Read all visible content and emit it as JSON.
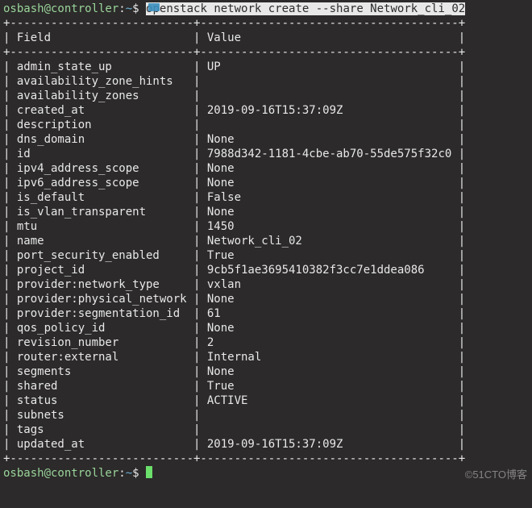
{
  "prompt": {
    "user": "osbash",
    "host": "controller",
    "path": "~",
    "symbol": "$"
  },
  "command": {
    "prefix": "openstack ",
    "rest": "network create --share Network_cli_02"
  },
  "table": {
    "header_field": "Field",
    "header_value": "Value",
    "rows": [
      {
        "field": "admin_state_up",
        "value": "UP"
      },
      {
        "field": "availability_zone_hints",
        "value": ""
      },
      {
        "field": "availability_zones",
        "value": ""
      },
      {
        "field": "created_at",
        "value": "2019-09-16T15:37:09Z"
      },
      {
        "field": "description",
        "value": ""
      },
      {
        "field": "dns_domain",
        "value": "None"
      },
      {
        "field": "id",
        "value": "7988d342-1181-4cbe-ab70-55de575f32c0"
      },
      {
        "field": "ipv4_address_scope",
        "value": "None"
      },
      {
        "field": "ipv6_address_scope",
        "value": "None"
      },
      {
        "field": "is_default",
        "value": "False"
      },
      {
        "field": "is_vlan_transparent",
        "value": "None"
      },
      {
        "field": "mtu",
        "value": "1450"
      },
      {
        "field": "name",
        "value": "Network_cli_02"
      },
      {
        "field": "port_security_enabled",
        "value": "True"
      },
      {
        "field": "project_id",
        "value": "9cb5f1ae3695410382f3cc7e1ddea086"
      },
      {
        "field": "provider:network_type",
        "value": "vxlan"
      },
      {
        "field": "provider:physical_network",
        "value": "None"
      },
      {
        "field": "provider:segmentation_id",
        "value": "61"
      },
      {
        "field": "qos_policy_id",
        "value": "None"
      },
      {
        "field": "revision_number",
        "value": "2"
      },
      {
        "field": "router:external",
        "value": "Internal"
      },
      {
        "field": "segments",
        "value": "None"
      },
      {
        "field": "shared",
        "value": "True"
      },
      {
        "field": "status",
        "value": "ACTIVE"
      },
      {
        "field": "subnets",
        "value": ""
      },
      {
        "field": "tags",
        "value": ""
      },
      {
        "field": "updated_at",
        "value": "2019-09-16T15:37:09Z"
      }
    ],
    "col1_width": 27,
    "col2_width": 38
  },
  "watermark": "©51CTO博客"
}
